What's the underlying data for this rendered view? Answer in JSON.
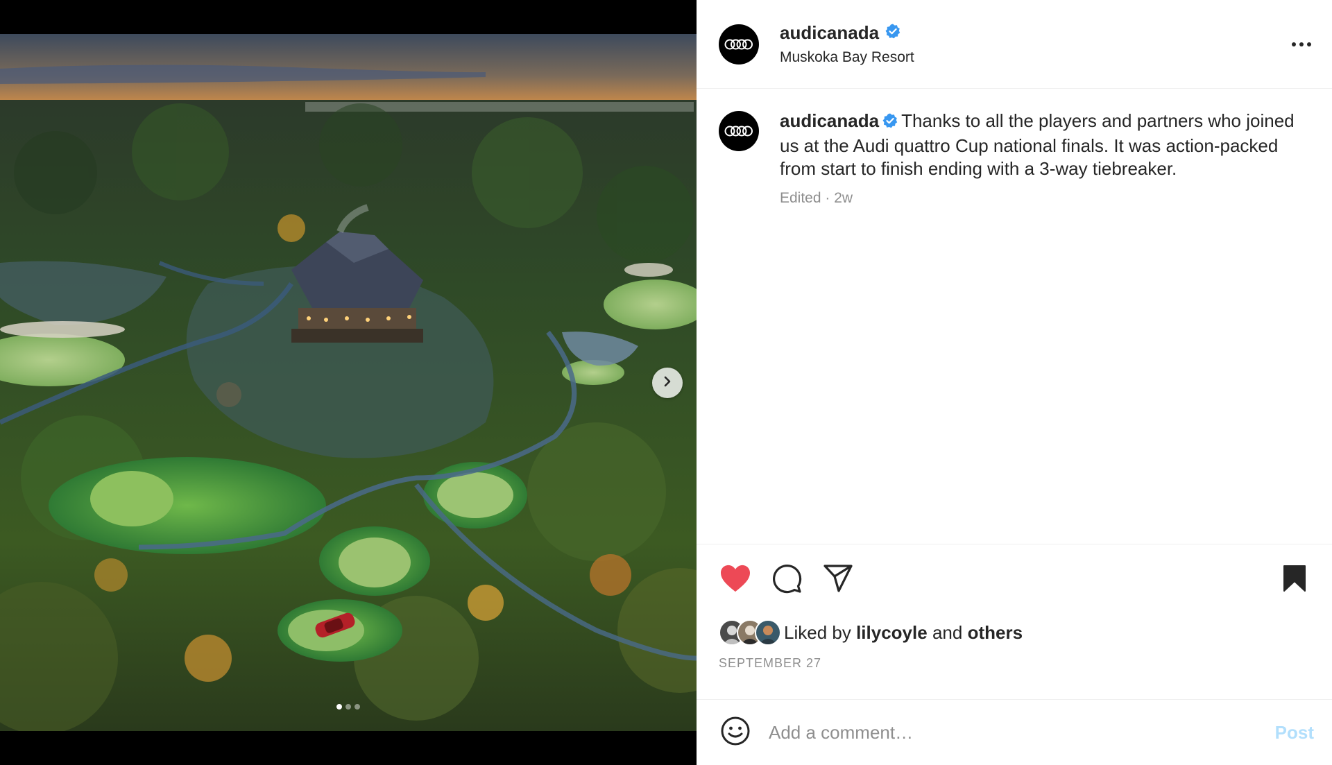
{
  "post": {
    "username": "audicanada",
    "location": "Muskoka Bay Resort",
    "caption": "Thanks to all the players and partners who joined us at the Audi quattro Cup national finals. It was action-packed from start to finish ending with a 3-way tiebreaker.",
    "edited_label": "Edited",
    "separator": "·",
    "age": "2w",
    "liked_by_prefix": "Liked by",
    "liked_by_user": "lilycoyle",
    "liked_by_and": "and",
    "liked_by_others": "others",
    "date": "SEPTEMBER 27"
  },
  "media": {
    "slide_count": 3,
    "active_slide": 1
  },
  "comment_box": {
    "placeholder": "Add a comment…",
    "post_label": "Post"
  },
  "colors": {
    "like_red": "#ED4956",
    "verified_blue": "#3897F0",
    "post_disabled": "#B2DFFC",
    "secondary_text": "#8E8E8E"
  },
  "icons": {
    "like": "heart-filled-icon",
    "comment": "comment-bubble-icon",
    "share": "paper-plane-icon",
    "save": "bookmark-filled-icon",
    "more": "ellipsis-icon",
    "emoji": "smiley-icon",
    "next": "chevron-right-icon",
    "verified": "verified-badge-icon"
  }
}
